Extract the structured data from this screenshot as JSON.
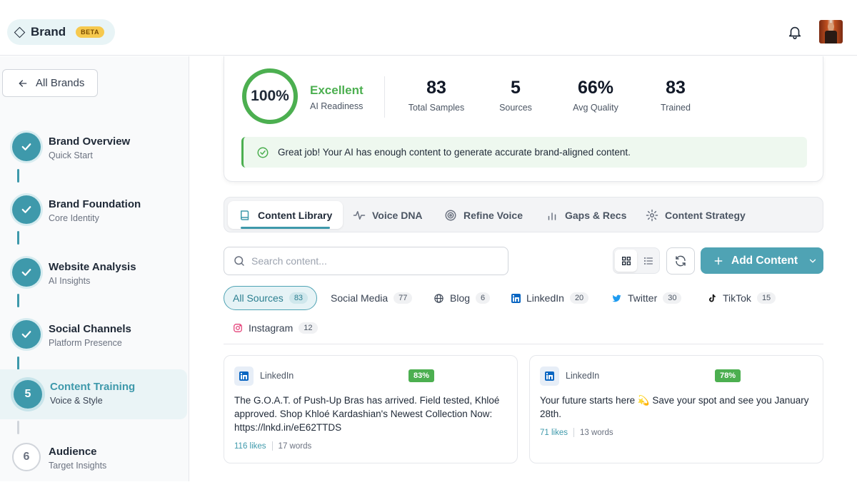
{
  "header": {
    "brand_name": "Brand",
    "beta_badge": "BETA"
  },
  "sidebar": {
    "back_label": "All Brands",
    "steps": [
      {
        "title": "Brand Overview",
        "subtitle": "Quick Start",
        "status": "done"
      },
      {
        "title": "Brand Foundation",
        "subtitle": "Core Identity",
        "status": "done"
      },
      {
        "title": "Website Analysis",
        "subtitle": "AI Insights",
        "status": "done"
      },
      {
        "title": "Social Channels",
        "subtitle": "Platform Presence",
        "status": "done"
      },
      {
        "title": "Content Training",
        "subtitle": "Voice & Style",
        "status": "active",
        "number": "5"
      },
      {
        "title": "Audience",
        "subtitle": "Target Insights",
        "status": "future",
        "number": "6"
      }
    ]
  },
  "readiness": {
    "percent": "100%",
    "level": "Excellent",
    "label": "AI Readiness",
    "stats": [
      {
        "value": "83",
        "label": "Total Samples"
      },
      {
        "value": "5",
        "label": "Sources"
      },
      {
        "value": "66%",
        "label": "Avg Quality"
      },
      {
        "value": "83",
        "label": "Trained"
      }
    ],
    "message": "Great job! Your AI has enough content to generate accurate brand-aligned content."
  },
  "tabs": [
    {
      "label": "Content Library",
      "icon": "book-icon",
      "active": true
    },
    {
      "label": "Voice DNA",
      "icon": "waveform-icon",
      "active": false
    },
    {
      "label": "Refine Voice",
      "icon": "target-icon",
      "active": false
    },
    {
      "label": "Gaps & Recs",
      "icon": "bar-chart-icon",
      "active": false
    },
    {
      "label": "Content Strategy",
      "icon": "gear-icon",
      "active": false
    }
  ],
  "toolbar": {
    "search_placeholder": "Search content...",
    "add_label": "Add Content"
  },
  "filters": [
    {
      "label": "All Sources",
      "count": "83",
      "active": true
    },
    {
      "label": "Social Media",
      "count": "77"
    },
    {
      "label": "Blog",
      "count": "6",
      "icon": "globe-icon"
    },
    {
      "label": "LinkedIn",
      "count": "20",
      "icon": "linkedin-icon"
    },
    {
      "label": "Twitter",
      "count": "30",
      "icon": "twitter-icon"
    },
    {
      "label": "TikTok",
      "count": "15",
      "icon": "tiktok-icon"
    },
    {
      "label": "Instagram",
      "count": "12",
      "icon": "instagram-icon"
    }
  ],
  "cards": [
    {
      "platform": "LinkedIn",
      "quality": "83%",
      "text": "The G.O.A.T. of Push-Up Bras has arrived. Field tested, Khloé approved. Shop Khloé Kardashian's Newest Collection Now: https://lnkd.in/eE62TTDS",
      "likes": "116 likes",
      "words": "17 words"
    },
    {
      "platform": "LinkedIn",
      "quality": "78%",
      "text": "Your future starts here 💫 Save your spot and see you January 28th.",
      "likes": "71 likes",
      "words": "13 words"
    }
  ],
  "colors": {
    "accent": "#3e99ab",
    "success": "#4caf50",
    "beta": "#f6c94e"
  }
}
